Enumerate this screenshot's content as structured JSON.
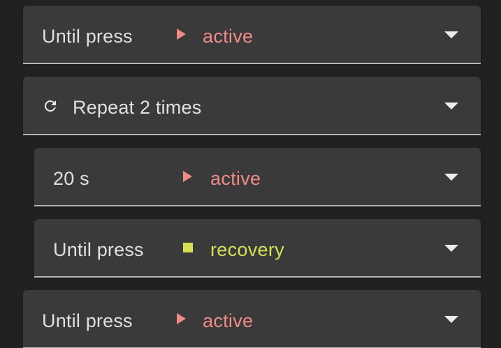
{
  "colors": {
    "background": "#212121",
    "card": "#3a3a3a",
    "active": "#ef8b86",
    "recovery": "#d4e157",
    "text": "#e0e0e0"
  },
  "steps": [
    {
      "duration": "Until press",
      "marker_icon": "play-triangle-icon",
      "state": "active"
    },
    {
      "repeat_icon": "repeat-icon",
      "repeat_label": "Repeat 2 times"
    },
    {
      "duration": "20 s",
      "marker_icon": "play-triangle-icon",
      "state": "active"
    },
    {
      "duration": "Until press",
      "marker_icon": "square-icon",
      "state": "recovery"
    },
    {
      "duration": "Until press",
      "marker_icon": "play-triangle-icon",
      "state": "active"
    }
  ]
}
